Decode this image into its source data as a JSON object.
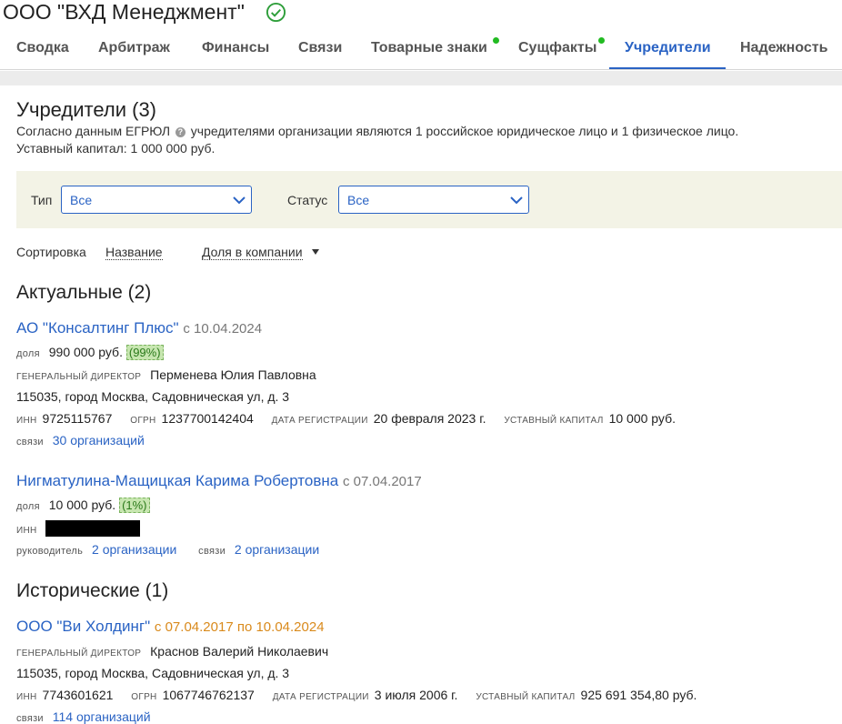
{
  "header": {
    "company_name": "ООО \"ВХД Менеджмент\"",
    "status_icon": "check-circle-icon",
    "accent_color": "#2a63c4",
    "status_color": "#2e9e3a"
  },
  "tabs": [
    {
      "label": "Сводка",
      "active": false,
      "dot": false
    },
    {
      "label": "Арбитраж",
      "active": false,
      "dot": false
    },
    {
      "label": "Финансы",
      "active": false,
      "dot": false
    },
    {
      "label": "Связи",
      "active": false,
      "dot": false
    },
    {
      "label": "Товарные знаки",
      "active": false,
      "dot": true
    },
    {
      "label": "Сущфакты",
      "active": false,
      "dot": true
    },
    {
      "label": "Учредители",
      "active": true,
      "dot": false
    },
    {
      "label": "Надежность",
      "active": false,
      "dot": false
    }
  ],
  "main": {
    "title": "Учредители (3)",
    "intro_prefix": "Согласно данным ЕГРЮЛ",
    "intro_suffix": "учредителями организации являются 1 российское юридическое лицо и 1 физическое лицо.",
    "capital": "Уставный капитал: 1 000 000 руб."
  },
  "filters": {
    "type_label": "Тип",
    "type_value": "Все",
    "status_label": "Статус",
    "status_value": "Все"
  },
  "sort": {
    "label": "Сортировка",
    "by_name": "Название",
    "by_share": "Доля в компании"
  },
  "current": {
    "heading": "Актуальные (2)",
    "items": [
      {
        "name": "АО \"Консалтинг Плюс\"",
        "since": "с 10.04.2024",
        "share_label": "доля",
        "share_value": "990 000 руб.",
        "share_percent": "(99%)",
        "director_label": "генеральный директор",
        "director": "Перменева Юлия Павловна",
        "address": "115035, город Москва, Садовническая ул, д. 3",
        "inn_label": "ИНН",
        "inn": "9725115767",
        "ogrn_label": "ОГРН",
        "ogrn": "1237700142404",
        "reg_label": "дата регистрации",
        "reg_date": "20 февраля 2023 г.",
        "capital_label": "уставный капитал",
        "capital": "10 000 руб.",
        "links_label": "связи",
        "links": "30 организаций"
      },
      {
        "name": "Нигматулина-Мащицкая Карима Робертовна",
        "since": "с 07.04.2017",
        "share_label": "доля",
        "share_value": "10 000 руб.",
        "share_percent": "(1%)",
        "inn_label": "ИНН",
        "head_label": "руководитель",
        "head_links": "2 организации",
        "links_label": "связи",
        "links": "2 организации"
      }
    ]
  },
  "historical": {
    "heading": "Исторические (1)",
    "items": [
      {
        "name": "ООО \"Ви Холдинг\"",
        "period": "с 07.04.2017 по 10.04.2024",
        "director_label": "генеральный директор",
        "director": "Краснов Валерий Николаевич",
        "address": "115035, город Москва, Садовническая ул, д. 3",
        "inn_label": "ИНН",
        "inn": "7743601621",
        "ogrn_label": "ОГРН",
        "ogrn": "1067746762137",
        "reg_label": "дата регистрации",
        "reg_date": "3 июля 2006 г.",
        "capital_label": "уставный капитал",
        "capital": "925 691 354,80 руб.",
        "links_label": "связи",
        "links": "114 организаций"
      }
    ]
  }
}
